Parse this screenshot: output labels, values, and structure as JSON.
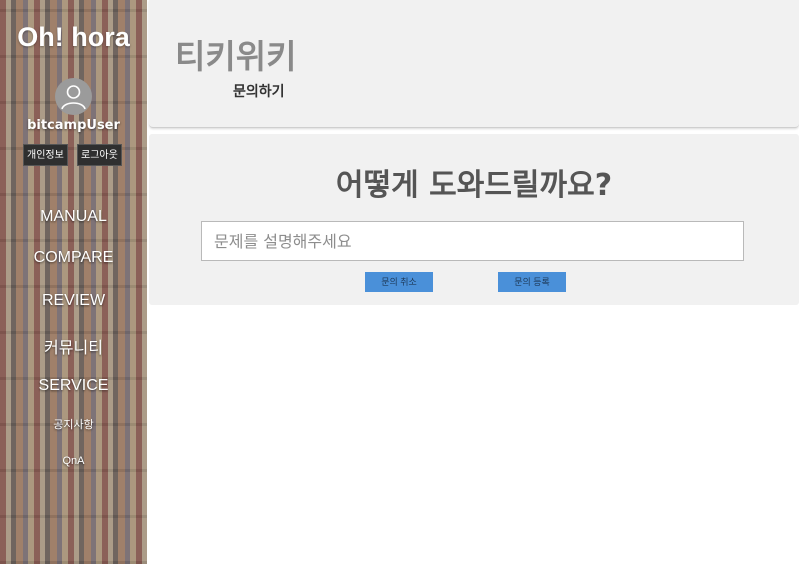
{
  "sidebar": {
    "brand": "Oh! hora",
    "username": "bitcampUser",
    "profile_button": "개인정보",
    "logout_button": "로그아웃",
    "nav": [
      "MANUAL",
      "COMPARE",
      "REVIEW",
      "커뮤니티",
      "SERVICE"
    ],
    "subnav": [
      "공지사항",
      "QnA"
    ]
  },
  "header": {
    "title": "티키위키",
    "subtitle": "문의하기"
  },
  "main": {
    "headline": "어떻게 도와드릴까요?",
    "input_placeholder": "문제를 설명해주세요",
    "input_value": "",
    "cancel_button": "문의 취소",
    "submit_button": "문의 등록"
  },
  "colors": {
    "button_blue": "#4a90d9",
    "card_bg": "#f1f1f1",
    "title_gray": "#8a8a8a"
  }
}
